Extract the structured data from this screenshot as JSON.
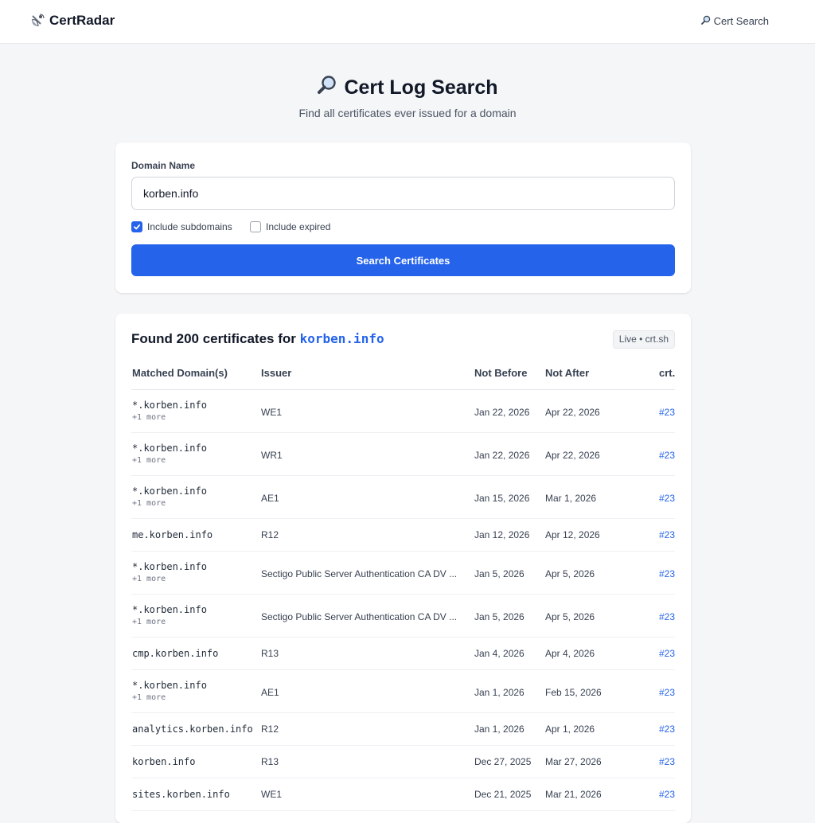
{
  "app": {
    "brand": "CertRadar",
    "nav_search": "Cert Search"
  },
  "hero": {
    "title": "Cert Log Search",
    "subtitle": "Find all certificates ever issued for a domain"
  },
  "search": {
    "label": "Domain Name",
    "value": "korben.info",
    "include_subdomains": {
      "label": "Include subdomains",
      "checked": true
    },
    "include_expired": {
      "label": "Include expired",
      "checked": false
    },
    "button": "Search Certificates"
  },
  "results": {
    "heading_prefix": "Found 200 certificates for",
    "heading_domain": "korben.info",
    "badge": "Live • crt.sh",
    "columns": [
      "Matched Domain(s)",
      "Issuer",
      "Not Before",
      "Not After",
      "crt."
    ],
    "rows": [
      {
        "domain": "*.korben.info",
        "more": "+1 more",
        "issuer": "WE1",
        "not_before": "Jan 22, 2026",
        "not_after": "Apr 22, 2026",
        "link": "#23"
      },
      {
        "domain": "*.korben.info",
        "more": "+1 more",
        "issuer": "WR1",
        "not_before": "Jan 22, 2026",
        "not_after": "Apr 22, 2026",
        "link": "#23"
      },
      {
        "domain": "*.korben.info",
        "more": "+1 more",
        "issuer": "AE1",
        "not_before": "Jan 15, 2026",
        "not_after": "Mar 1, 2026",
        "link": "#23"
      },
      {
        "domain": "me.korben.info",
        "more": "",
        "issuer": "R12",
        "not_before": "Jan 12, 2026",
        "not_after": "Apr 12, 2026",
        "link": "#23"
      },
      {
        "domain": "*.korben.info",
        "more": "+1 more",
        "issuer": "Sectigo Public Server Authentication CA DV ...",
        "not_before": "Jan 5, 2026",
        "not_after": "Apr 5, 2026",
        "link": "#23"
      },
      {
        "domain": "*.korben.info",
        "more": "+1 more",
        "issuer": "Sectigo Public Server Authentication CA DV ...",
        "not_before": "Jan 5, 2026",
        "not_after": "Apr 5, 2026",
        "link": "#23"
      },
      {
        "domain": "cmp.korben.info",
        "more": "",
        "issuer": "R13",
        "not_before": "Jan 4, 2026",
        "not_after": "Apr 4, 2026",
        "link": "#23"
      },
      {
        "domain": "*.korben.info",
        "more": "+1 more",
        "issuer": "AE1",
        "not_before": "Jan 1, 2026",
        "not_after": "Feb 15, 2026",
        "link": "#23"
      },
      {
        "domain": "analytics.korben.info",
        "more": "",
        "issuer": "R12",
        "not_before": "Jan 1, 2026",
        "not_after": "Apr 1, 2026",
        "link": "#23"
      },
      {
        "domain": "korben.info",
        "more": "",
        "issuer": "R13",
        "not_before": "Dec 27, 2025",
        "not_after": "Mar 27, 2026",
        "link": "#23"
      },
      {
        "domain": "sites.korben.info",
        "more": "",
        "issuer": "WE1",
        "not_before": "Dec 21, 2025",
        "not_after": "Mar 21, 2026",
        "link": "#23"
      }
    ]
  },
  "colors": {
    "accent": "#2563eb",
    "background": "#f5f6f8"
  },
  "icons": {
    "brand": "satellite-dish-icon",
    "search": "magnifier-icon",
    "check": "check-icon"
  }
}
